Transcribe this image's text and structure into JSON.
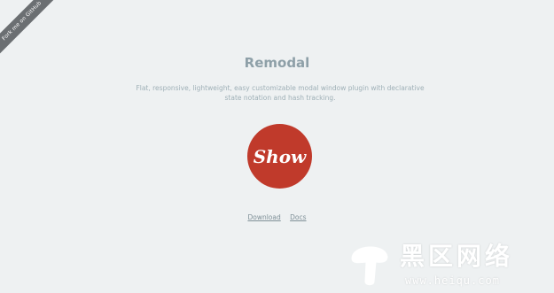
{
  "ribbon": {
    "label": "Fork me on GitHub"
  },
  "header": {
    "title": "Remodal",
    "description": "Flat, responsive, lightweight, easy customizable modal window plugin with declarative state notation and hash tracking."
  },
  "main": {
    "show_label": "Show"
  },
  "links": {
    "download": "Download",
    "docs": "Docs"
  },
  "watermark": {
    "title": "黑区网络",
    "url": "www.heiqu.com"
  },
  "colors": {
    "background": "#eef1f2",
    "accent": "#c03a2b",
    "title": "#8ea0a8",
    "text": "#9fb0b7",
    "ribbon": "#6b6f72"
  }
}
